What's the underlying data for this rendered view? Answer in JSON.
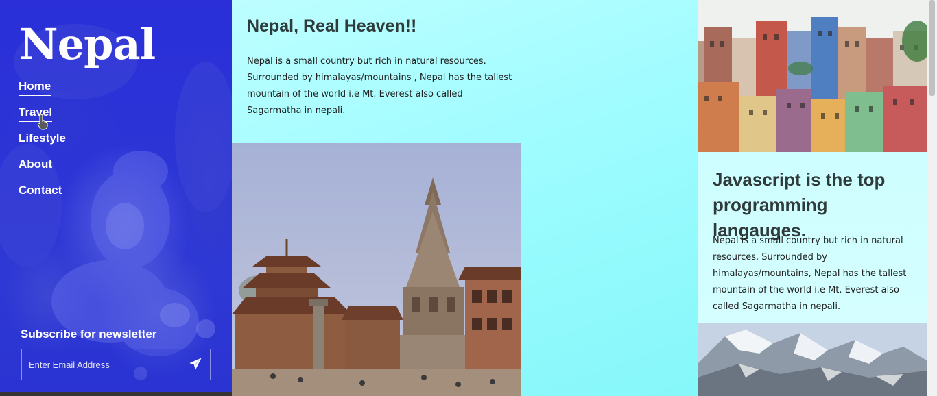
{
  "sidebar": {
    "logo": "Nepal",
    "nav": [
      {
        "label": "Home",
        "active": true
      },
      {
        "label": "Travel",
        "active": false
      },
      {
        "label": "Lifestyle",
        "active": false
      },
      {
        "label": "About",
        "active": false
      },
      {
        "label": "Contact",
        "active": false
      }
    ],
    "newsletter": {
      "title": "Subscribe for newsletter",
      "placeholder": "Enter Email Address",
      "send_icon": "paper-plane-icon"
    }
  },
  "main": {
    "title": "Nepal, Real Heaven!!",
    "text": "Nepal is a small country but rich in natural resources. Surrounded by himalayas/mountains , Nepal has the tallest mountain of the world i.e Mt. Everest also called Sagarmatha in nepali."
  },
  "right": {
    "title": "Javascript is the top programming langauges.",
    "text": "Nepal is a small country but rich in natural resources. Surrounded by himalayas/mountains, Nepal has the tallest mountain of the world i.e Mt. Everest also called Sagarmatha in nepali."
  },
  "colors": {
    "sidebar_blue": "#2b34d6",
    "page_cyan": "#9ffcff",
    "heading_text": "#2f3b3b"
  }
}
